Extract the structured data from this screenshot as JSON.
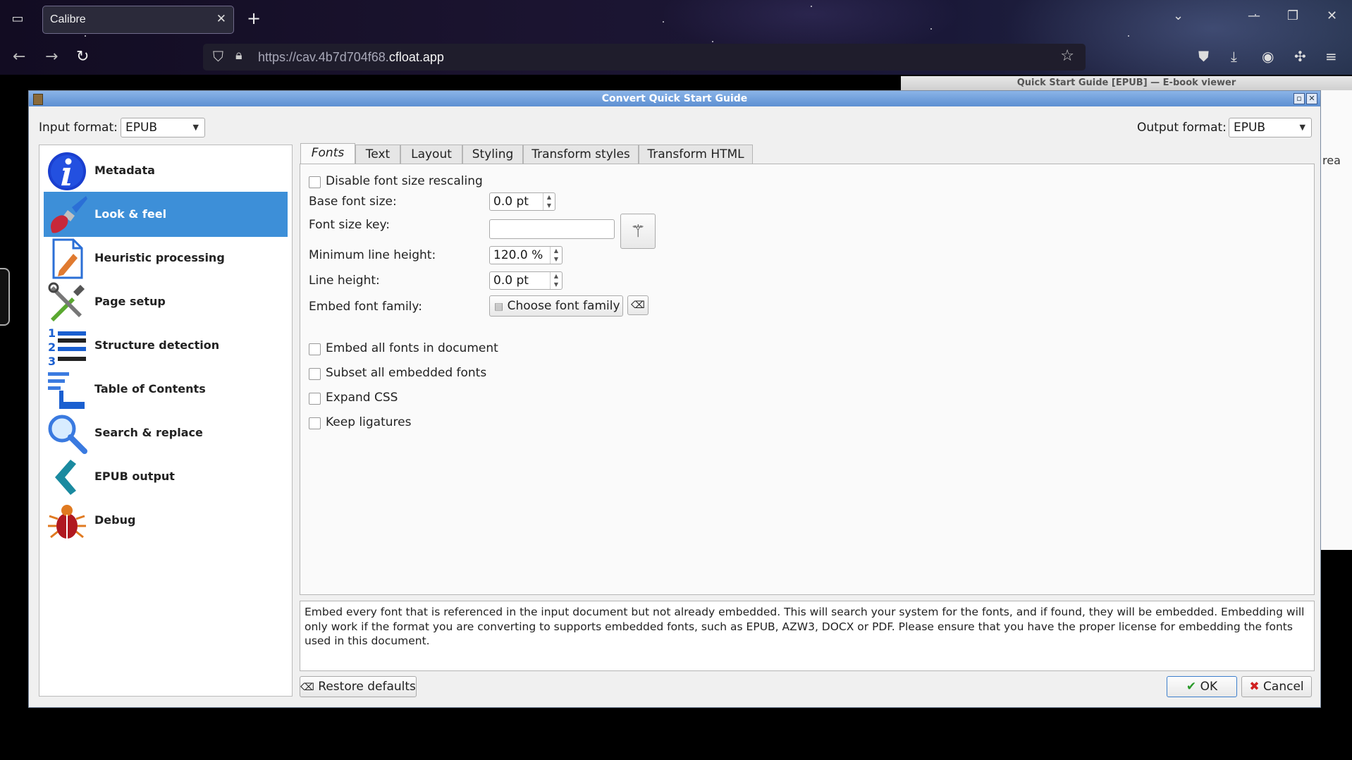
{
  "browser": {
    "tab_title": "Calibre",
    "tab_close_icon": "close-icon",
    "url_prefix": "https://cav.4b7d704f68.",
    "url_domain": "cfloat.app"
  },
  "viewer": {
    "title": "Quick Start Guide [EPUB] — E-book viewer",
    "peek_text": "rea"
  },
  "dialog": {
    "title": "Convert Quick Start Guide",
    "input_format_label": "Input format:",
    "input_format_value": "EPUB",
    "output_format_label": "Output format:",
    "output_format_value": "EPUB"
  },
  "nav": {
    "items": [
      {
        "label": "Metadata",
        "icon": "info-icon"
      },
      {
        "label": "Look & feel",
        "icon": "paintbrush-icon"
      },
      {
        "label": "Heuristic processing",
        "icon": "document-edit-icon"
      },
      {
        "label": "Page setup",
        "icon": "tools-icon"
      },
      {
        "label": "Structure detection",
        "icon": "numbered-list-icon"
      },
      {
        "label": "Table of Contents",
        "icon": "toc-icon"
      },
      {
        "label": "Search & replace",
        "icon": "magnifier-icon"
      },
      {
        "label": "EPUB output",
        "icon": "chevron-left-icon"
      },
      {
        "label": "Debug",
        "icon": "bug-icon"
      }
    ],
    "selected_index": 1
  },
  "tabs": [
    "Fonts",
    "Text",
    "Layout",
    "Styling",
    "Transform styles",
    "Transform HTML"
  ],
  "fonts": {
    "disable_rescaling": "Disable font size rescaling",
    "base_font_size_label": "Base font size:",
    "base_font_size_value": "0.0 pt",
    "font_size_key_label": "Font size key:",
    "font_size_key_value": "",
    "min_line_height_label": "Minimum line height:",
    "min_line_height_value": "120.0 %",
    "line_height_label": "Line height:",
    "line_height_value": "0.0 pt",
    "embed_font_family_label": "Embed font family:",
    "choose_font_family": "Choose font family",
    "embed_all_fonts": "Embed all fonts in document",
    "subset_fonts": "Subset all embedded fonts",
    "expand_css": "Expand CSS",
    "keep_ligatures": "Keep ligatures"
  },
  "help_text": "Embed every font that is referenced in the input document but not already embedded. This will search your system for the fonts, and if found, they will be embedded. Embedding will only work if the format you are converting to supports embedded fonts, such as EPUB, AZW3, DOCX or PDF. Please ensure that you have the proper license for embedding the fonts used in this document.",
  "buttons": {
    "restore_defaults": "Restore defaults",
    "ok": "OK",
    "cancel": "Cancel"
  },
  "colors": {
    "selection": "#3d8fd8",
    "titlebar": "#5d8fd2"
  }
}
